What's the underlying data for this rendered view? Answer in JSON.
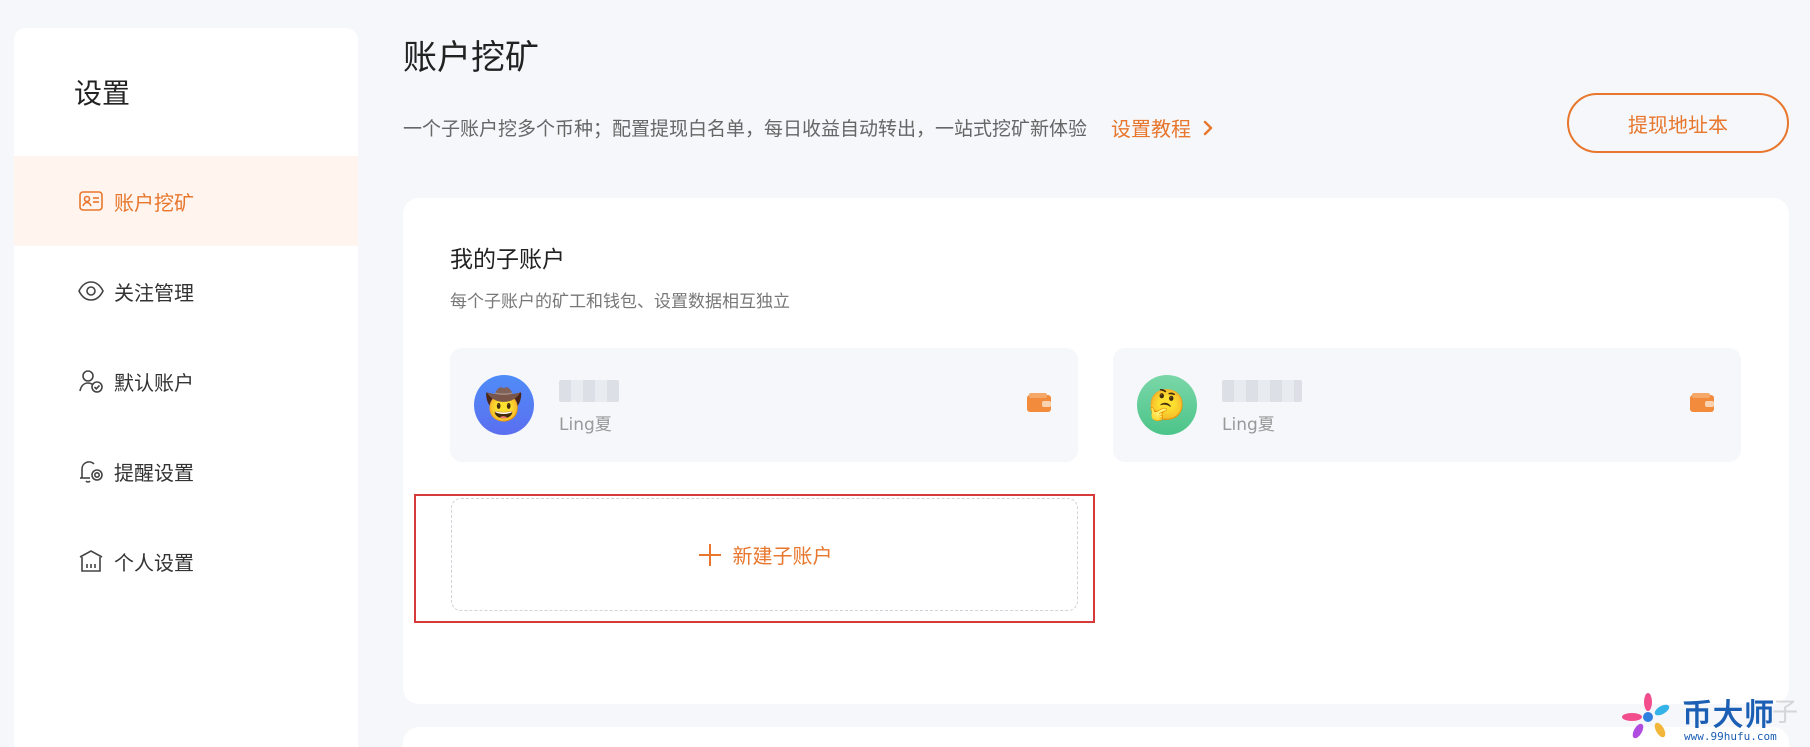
{
  "sidebar": {
    "title": "设置",
    "items": [
      {
        "label": "账户挖矿",
        "icon": "id-card-icon",
        "active": true
      },
      {
        "label": "关注管理",
        "icon": "eye-icon",
        "active": false
      },
      {
        "label": "默认账户",
        "icon": "user-check-icon",
        "active": false
      },
      {
        "label": "提醒设置",
        "icon": "bell-gear-icon",
        "active": false
      },
      {
        "label": "个人设置",
        "icon": "home-icon",
        "active": false
      }
    ]
  },
  "header": {
    "title": "账户挖矿",
    "subtitle": "一个子账户挖多个币种；配置提现白名单，每日收益自动转出，一站式挖矿新体验",
    "tutorial_link": "设置教程",
    "address_book_button": "提现地址本"
  },
  "subaccounts": {
    "title": "我的子账户",
    "description": "每个子账户的矿工和钱包、设置数据相互独立",
    "accounts": [
      {
        "sub_label": "Ling夏",
        "avatar_emoji": "🤠",
        "avatar_color": "#5b7ff2"
      },
      {
        "sub_label": "Ling夏",
        "avatar_emoji": "🤔",
        "avatar_color": "#5fcd98"
      }
    ],
    "new_account_button": "新建子账户"
  },
  "watermark": {
    "brand": "币大师",
    "ghost": "子",
    "url": "www.99hufu.com"
  },
  "colors": {
    "accent": "#e8762c",
    "highlight_border": "#d73a3a",
    "background": "#f5f7fa"
  }
}
